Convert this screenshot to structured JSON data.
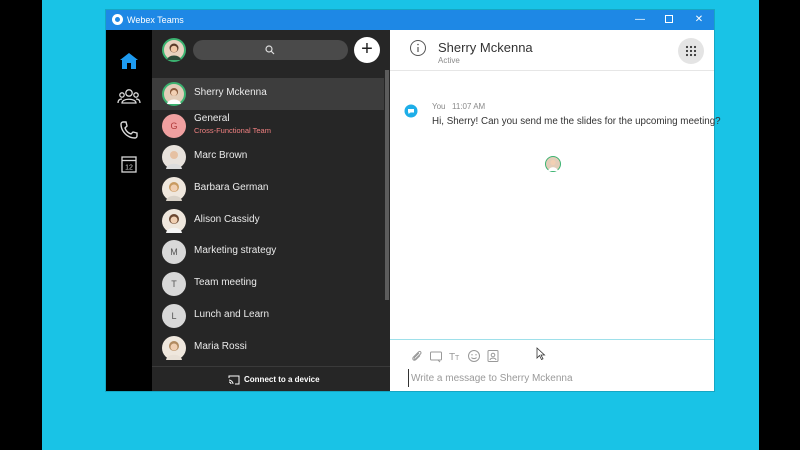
{
  "window": {
    "title": "Webex Teams",
    "controls": {
      "minimize": "—",
      "maximize": "",
      "close": "✕"
    }
  },
  "rail": {
    "items": [
      {
        "icon": "home-icon",
        "active": true
      },
      {
        "icon": "teams-icon"
      },
      {
        "icon": "phone-icon"
      },
      {
        "icon": "calendar-icon",
        "label": "12"
      }
    ]
  },
  "sidebar": {
    "add_label": "+",
    "conversations": [
      {
        "name": "Sherry Mckenna",
        "selected": true,
        "avatar": "photo"
      },
      {
        "name": "General",
        "subtitle": "Cross-Functional Team",
        "initial": "G"
      },
      {
        "name": "Marc Brown",
        "avatar": "photo"
      },
      {
        "name": "Barbara German",
        "avatar": "photo"
      },
      {
        "name": "Alison Cassidy",
        "avatar": "photo"
      },
      {
        "name": "Marketing strategy",
        "initial": "M"
      },
      {
        "name": "Team meeting",
        "initial": "T"
      },
      {
        "name": "Lunch and Learn",
        "initial": "L"
      },
      {
        "name": "Maria Rossi",
        "avatar": "photo"
      }
    ],
    "device_label": "Connect to a device"
  },
  "chat": {
    "contact_name": "Sherry Mckenna",
    "status": "Active",
    "messages": [
      {
        "sender": "You",
        "time": "11:07 AM",
        "text": "Hi, Sherry! Can you send me the slides for the upcoming meeting?"
      }
    ],
    "compose_placeholder": "Write a message to Sherry Mckenna"
  },
  "colors": {
    "accent": "#1e88e5",
    "desktop": "#19c3e6",
    "presence": "#3cb371",
    "sidebar_bg": "#262626"
  }
}
